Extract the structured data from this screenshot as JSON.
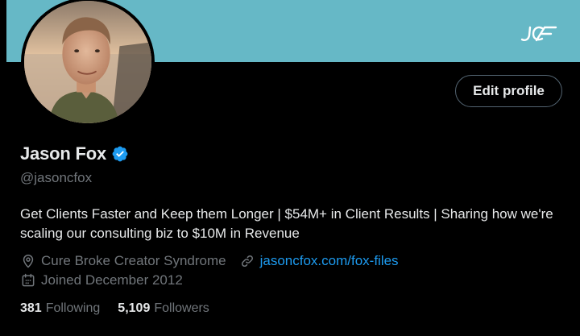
{
  "banner": {
    "color": "#66b8c6",
    "logo_text": "JCF"
  },
  "profile": {
    "display_name": "Jason Fox",
    "handle": "@jasoncfox",
    "verified_icon": "verified-badge-icon",
    "bio": "Get Clients Faster and Keep them Longer | $54M+ in Client Results | Sharing how we're scaling our consulting biz to $10M in Revenue",
    "location": "Cure Broke Creator Syndrome",
    "location_icon": "location-pin-icon",
    "website": "jasoncfox.com/fox-files",
    "website_icon": "link-icon",
    "joined": "Joined December 2012",
    "joined_icon": "calendar-icon"
  },
  "actions": {
    "edit_profile_label": "Edit profile"
  },
  "stats": {
    "following_count": "381",
    "following_label": "Following",
    "followers_count": "5,109",
    "followers_label": "Followers"
  },
  "colors": {
    "accent": "#1d9bf0",
    "muted_text": "#71767b",
    "primary_text": "#e7e9ea",
    "background": "#000000"
  }
}
